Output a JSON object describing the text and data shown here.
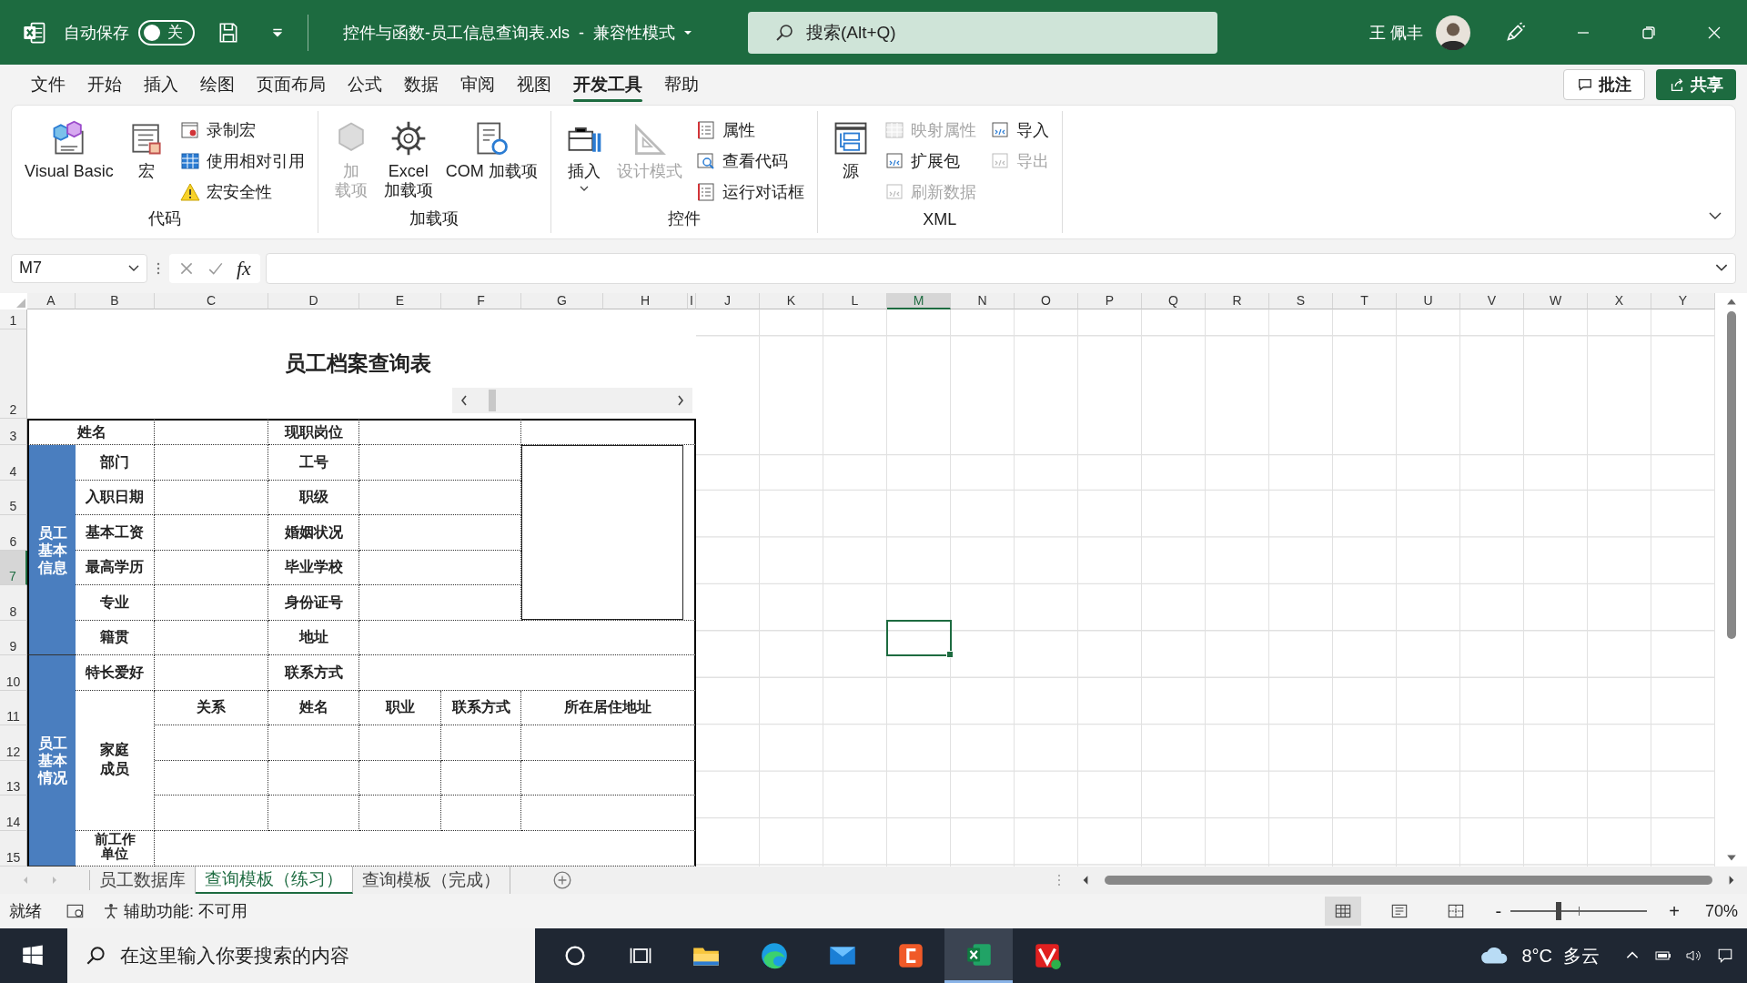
{
  "title_bar": {
    "autosave_label": "自动保存",
    "autosave_toggle": {
      "on": false,
      "label": "关"
    },
    "document_title": "控件与函数-员工信息查询表.xls  -  兼容性模式",
    "search": {
      "placeholder": "搜索(Alt+Q)"
    },
    "user_name": "王 佩丰"
  },
  "menu_tabs": [
    {
      "label": "文件",
      "selected": false
    },
    {
      "label": "开始",
      "selected": false
    },
    {
      "label": "插入",
      "selected": false
    },
    {
      "label": "绘图",
      "selected": false
    },
    {
      "label": "页面布局",
      "selected": false
    },
    {
      "label": "公式",
      "selected": false
    },
    {
      "label": "数据",
      "selected": false
    },
    {
      "label": "审阅",
      "selected": false
    },
    {
      "label": "视图",
      "selected": false
    },
    {
      "label": "开发工具",
      "selected": true
    },
    {
      "label": "帮助",
      "selected": false
    }
  ],
  "menu_buttons": [
    {
      "label": "批注",
      "kind": "outline"
    },
    {
      "label": "共享",
      "kind": "primary"
    }
  ],
  "ribbon_groups": [
    {
      "label": "代码",
      "items": [
        {
          "kind": "large",
          "lines": [
            "Visual Basic"
          ],
          "disabled": false,
          "menu": false
        },
        {
          "kind": "large",
          "lines": [
            "宏"
          ],
          "disabled": false,
          "menu": false
        },
        {
          "kind": "small",
          "lines": [
            "录制宏"
          ],
          "disabled": false,
          "menu": false
        },
        {
          "kind": "small",
          "lines": [
            "使用相对引用"
          ],
          "disabled": false,
          "menu": false
        },
        {
          "kind": "small",
          "lines": [
            "宏安全性"
          ],
          "disabled": false,
          "menu": false
        }
      ]
    },
    {
      "label": "加载项",
      "items": [
        {
          "kind": "large",
          "lines": [
            "加",
            "载项"
          ],
          "disabled": true,
          "menu": false
        },
        {
          "kind": "large",
          "lines": [
            "Excel",
            "加载项"
          ],
          "disabled": false,
          "menu": false
        },
        {
          "kind": "large",
          "lines": [
            "COM 加载项"
          ],
          "disabled": false,
          "menu": false
        }
      ]
    },
    {
      "label": "控件",
      "items": [
        {
          "kind": "large",
          "lines": [
            "插入"
          ],
          "disabled": false,
          "menu": true
        },
        {
          "kind": "large",
          "lines": [
            "设计模式"
          ],
          "disabled": true,
          "menu": false
        },
        {
          "kind": "small",
          "lines": [
            "属性"
          ],
          "disabled": false,
          "menu": false
        },
        {
          "kind": "small",
          "lines": [
            "查看代码"
          ],
          "disabled": false,
          "menu": false
        },
        {
          "kind": "small",
          "lines": [
            "运行对话框"
          ],
          "disabled": false,
          "menu": false
        }
      ]
    },
    {
      "label": "XML",
      "items": [
        {
          "kind": "large",
          "lines": [
            "源"
          ],
          "disabled": false,
          "menu": false
        },
        {
          "kind": "small",
          "lines": [
            "映射属性"
          ],
          "disabled": true,
          "menu": false
        },
        {
          "kind": "small",
          "lines": [
            "扩展包"
          ],
          "disabled": false,
          "menu": false
        },
        {
          "kind": "small",
          "lines": [
            "刷新数据"
          ],
          "disabled": true,
          "menu": false
        },
        {
          "kind": "small",
          "lines": [
            "导入"
          ],
          "disabled": false,
          "menu": false
        },
        {
          "kind": "small",
          "lines": [
            "导出"
          ],
          "disabled": true,
          "menu": false
        }
      ]
    }
  ],
  "formula_bar": {
    "name_box": "M7",
    "fx": "fx"
  },
  "sheet": {
    "columns": [
      {
        "label": "A",
        "selected": false
      },
      {
        "label": "B",
        "selected": false
      },
      {
        "label": "C",
        "selected": false
      },
      {
        "label": "D",
        "selected": false
      },
      {
        "label": "E",
        "selected": false
      },
      {
        "label": "F",
        "selected": false
      },
      {
        "label": "G",
        "selected": false
      },
      {
        "label": "H",
        "selected": false
      },
      {
        "label": "I",
        "selected": false
      },
      {
        "label": "J",
        "selected": false
      },
      {
        "label": "K",
        "selected": false
      },
      {
        "label": "L",
        "selected": false
      },
      {
        "label": "M",
        "selected": true
      },
      {
        "label": "N",
        "selected": false
      },
      {
        "label": "O",
        "selected": false
      },
      {
        "label": "P",
        "selected": false
      },
      {
        "label": "Q",
        "selected": false
      },
      {
        "label": "R",
        "selected": false
      },
      {
        "label": "S",
        "selected": false
      },
      {
        "label": "T",
        "selected": false
      },
      {
        "label": "U",
        "selected": false
      },
      {
        "label": "V",
        "selected": false
      },
      {
        "label": "W",
        "selected": false
      },
      {
        "label": "X",
        "selected": false
      },
      {
        "label": "Y",
        "selected": false
      }
    ],
    "rows": [
      {
        "label": "1",
        "selected": false
      },
      {
        "label": "2",
        "selected": false
      },
      {
        "label": "3",
        "selected": false
      },
      {
        "label": "4",
        "selected": false
      },
      {
        "label": "5",
        "selected": false
      },
      {
        "label": "6",
        "selected": false
      },
      {
        "label": "7",
        "selected": true
      },
      {
        "label": "8",
        "selected": false
      },
      {
        "label": "9",
        "selected": false
      },
      {
        "label": "10",
        "selected": false
      },
      {
        "label": "11",
        "selected": false
      },
      {
        "label": "12",
        "selected": false
      },
      {
        "label": "13",
        "selected": false
      },
      {
        "label": "14",
        "selected": false
      },
      {
        "label": "15",
        "selected": false
      }
    ]
  },
  "form": {
    "title": "员工档案查询表",
    "name_label": "姓名",
    "position_label": "现职岗位",
    "section_labels": [
      "员工基本信息",
      "员工基本情况"
    ],
    "field_rows": [
      {
        "left": "部门",
        "right": "工号"
      },
      {
        "left": "入职日期",
        "right": "职级"
      },
      {
        "left": "基本工资",
        "right": "婚姻状况"
      },
      {
        "left": "最高学历",
        "right": "毕业学校"
      },
      {
        "left": "专业",
        "right": "身份证号"
      },
      {
        "left": "籍贯",
        "right": "地址"
      },
      {
        "left": "特长爱好",
        "right": "联系方式"
      }
    ],
    "family_label": "家庭成员",
    "family_columns": [
      "关系",
      "姓名",
      "职业",
      "联系方式",
      "所在居住地址"
    ],
    "previous_work_label": "前工作单位"
  },
  "sheet_tabs": [
    {
      "label": "员工数据库",
      "selected": false
    },
    {
      "label": "查询模板（练习）",
      "selected": true
    },
    {
      "label": "查询模板（完成）",
      "selected": false
    }
  ],
  "status_bar": {
    "ready": "就绪",
    "accessibility": "辅助功能: 不可用",
    "views": [
      {
        "selected": true
      },
      {
        "selected": false
      },
      {
        "selected": false
      }
    ],
    "zoom_out": "-",
    "zoom_in": "+",
    "zoom": {
      "level": 0.35
    },
    "zoom_reading": "70%"
  },
  "taskbar": {
    "search_placeholder": "在这里输入你要搜索的内容",
    "apps": [
      {
        "selected": false
      },
      {
        "selected": false
      },
      {
        "selected": false
      },
      {
        "selected": false
      },
      {
        "selected": true
      },
      {
        "selected": false
      }
    ],
    "weather": {
      "temperature": "8°C",
      "condition": "多云"
    }
  }
}
